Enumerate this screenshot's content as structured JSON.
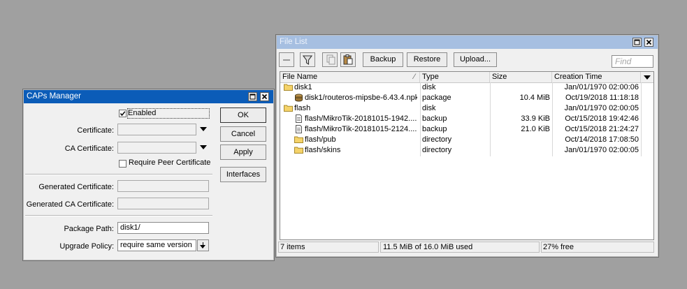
{
  "caps": {
    "title": "CAPs Manager",
    "enabled_label": "Enabled",
    "certificate_label": "Certificate:",
    "ca_certificate_label": "CA Certificate:",
    "require_peer_label": "Require Peer Certificate",
    "generated_certificate_label": "Generated Certificate:",
    "generated_ca_label": "Generated CA Certificate:",
    "package_path_label": "Package Path:",
    "package_path_value": "disk1/",
    "upgrade_policy_label": "Upgrade Policy:",
    "upgrade_policy_value": "require same version",
    "buttons": {
      "ok": "OK",
      "cancel": "Cancel",
      "apply": "Apply",
      "interfaces": "Interfaces"
    }
  },
  "files": {
    "title": "File List",
    "toolbar": {
      "backup": "Backup",
      "restore": "Restore",
      "upload": "Upload..."
    },
    "find_placeholder": "Find",
    "columns": [
      "File Name",
      "Type",
      "Size",
      "Creation Time"
    ],
    "rows": [
      {
        "name": "disk1",
        "type": "disk",
        "size": "",
        "time": "Jan/01/1970 02:00:06",
        "icon": "folder-icon",
        "indent": 0
      },
      {
        "name": "disk1/routeros-mipsbe-6.43.4.npk",
        "type": "package",
        "size": "10.4 MiB",
        "time": "Oct/19/2018 11:18:18",
        "icon": "package-icon",
        "indent": 1
      },
      {
        "name": "flash",
        "type": "disk",
        "size": "",
        "time": "Jan/01/1970 02:00:05",
        "icon": "folder-icon",
        "indent": 0
      },
      {
        "name": "flash/MikroTik-20181015-1942....",
        "type": "backup",
        "size": "33.9 KiB",
        "time": "Oct/15/2018 19:42:46",
        "icon": "file-icon",
        "indent": 1
      },
      {
        "name": "flash/MikroTik-20181015-2124....",
        "type": "backup",
        "size": "21.0 KiB",
        "time": "Oct/15/2018 21:24:27",
        "icon": "file-icon",
        "indent": 1
      },
      {
        "name": "flash/pub",
        "type": "directory",
        "size": "",
        "time": "Oct/14/2018 17:08:50",
        "icon": "folder-icon",
        "indent": 1
      },
      {
        "name": "flash/skins",
        "type": "directory",
        "size": "",
        "time": "Jan/01/1970 02:00:05",
        "icon": "folder-icon",
        "indent": 1
      }
    ],
    "status": {
      "items": "7 items",
      "usage": "11.5 MiB of 16.0 MiB used",
      "free": "27% free"
    }
  },
  "colors": {
    "desktop": "#a0a0a0",
    "active_title": "#0b5cb8",
    "inactive_title": "#a6bfe1",
    "folder": "#f5d36a"
  }
}
